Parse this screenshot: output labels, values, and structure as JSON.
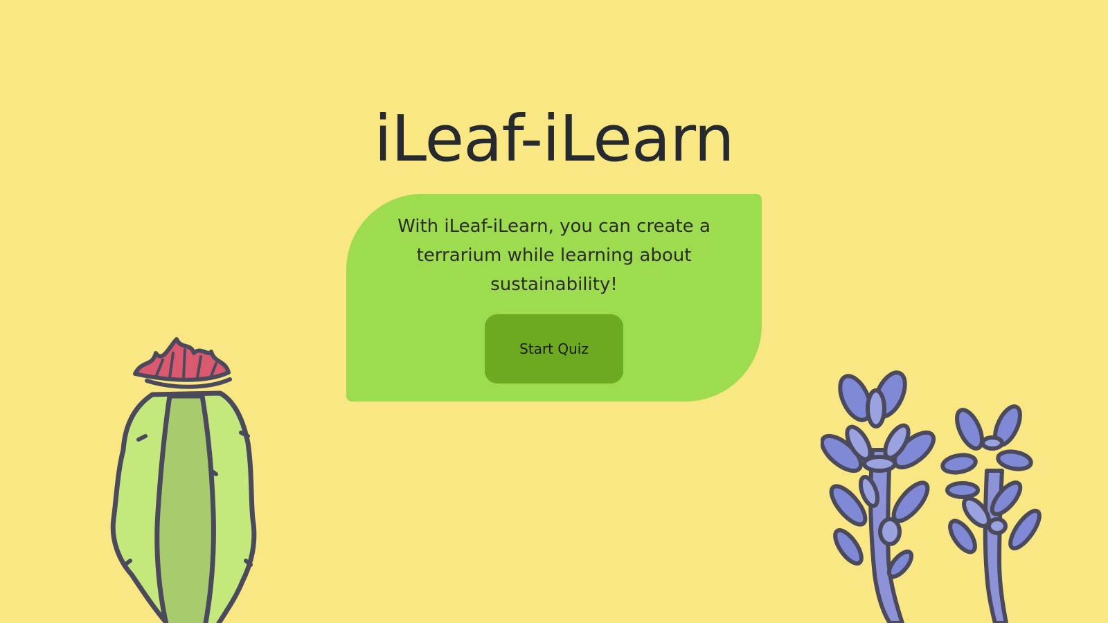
{
  "header": {
    "title": "iLeaf-iLearn"
  },
  "intro": {
    "text": "With iLeaf-iLearn, you can create a terrarium while learning about sustainability!",
    "button_label": "Start Quiz"
  },
  "colors": {
    "background": "#f9e784",
    "card": "#9ddc4e",
    "button": "#6ea922",
    "text": "#262a2e"
  },
  "illustrations": {
    "left": "cactus-icon",
    "right": "succulent-icon"
  }
}
